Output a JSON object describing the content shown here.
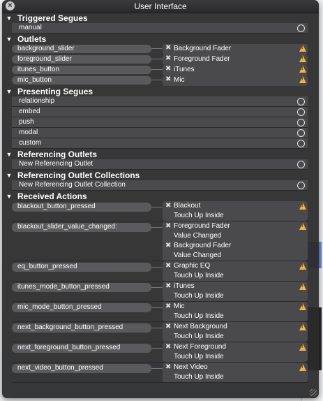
{
  "window": {
    "title": "User Interface"
  },
  "sections": {
    "triggered_segues": "Triggered Segues",
    "outlets": "Outlets",
    "presenting_segues": "Presenting Segues",
    "referencing_outlets": "Referencing Outlets",
    "referencing_outlet_collections": "Referencing Outlet Collections",
    "received_actions": "Received Actions"
  },
  "triggered_segues": [
    "manual"
  ],
  "outlets": [
    {
      "name": "background_slider",
      "target": "Background Fader"
    },
    {
      "name": "foreground_slider",
      "target": "Foreground Fader"
    },
    {
      "name": "itunes_button",
      "target": "iTunes"
    },
    {
      "name": "mic_button",
      "target": "Mic"
    }
  ],
  "presenting_segues": [
    "relationship",
    "embed",
    "push",
    "modal",
    "custom"
  ],
  "referencing_outlets": [
    "New Referencing Outlet"
  ],
  "referencing_outlet_collections": [
    "New Referencing Outlet Collection"
  ],
  "received_actions": [
    {
      "name": "blackout_button_pressed",
      "targets": [
        {
          "object": "Blackout",
          "event": "Touch Up Inside"
        }
      ]
    },
    {
      "name": "blackout_slider_value_changed:",
      "targets": [
        {
          "object": "Foreground Fader",
          "event": "Value Changed"
        },
        {
          "object": "Background Fader",
          "event": "Value Changed"
        }
      ]
    },
    {
      "name": "eq_button_pressed",
      "targets": [
        {
          "object": "Graphic EQ",
          "event": "Touch Up Inside"
        }
      ]
    },
    {
      "name": "itunes_mode_button_pressed",
      "targets": [
        {
          "object": "iTunes",
          "event": "Touch Up Inside"
        }
      ]
    },
    {
      "name": "mic_mode_button_pressed",
      "targets": [
        {
          "object": "Mic",
          "event": "Touch Up Inside"
        }
      ]
    },
    {
      "name": "next_background_button_pressed",
      "targets": [
        {
          "object": "Next Background",
          "event": "Touch Up Inside"
        }
      ]
    },
    {
      "name": "next_foreground_button_pressed",
      "targets": [
        {
          "object": "Next Foreground",
          "event": "Touch Up Inside"
        }
      ]
    },
    {
      "name": "next_video_button_pressed",
      "targets": [
        {
          "object": "Next Video",
          "event": "Touch Up Inside"
        }
      ]
    }
  ],
  "icons": {
    "close": "close-icon",
    "disclosure": "disclosure-triangle-icon",
    "connection": "connection-circle-icon",
    "remove": "remove-connection-icon",
    "warning": "warning-icon"
  },
  "colors": {
    "panel": "#2a2a2c",
    "row": "#4a4a4c",
    "pill": "#5a5a5c",
    "warning": "#f0b240"
  }
}
